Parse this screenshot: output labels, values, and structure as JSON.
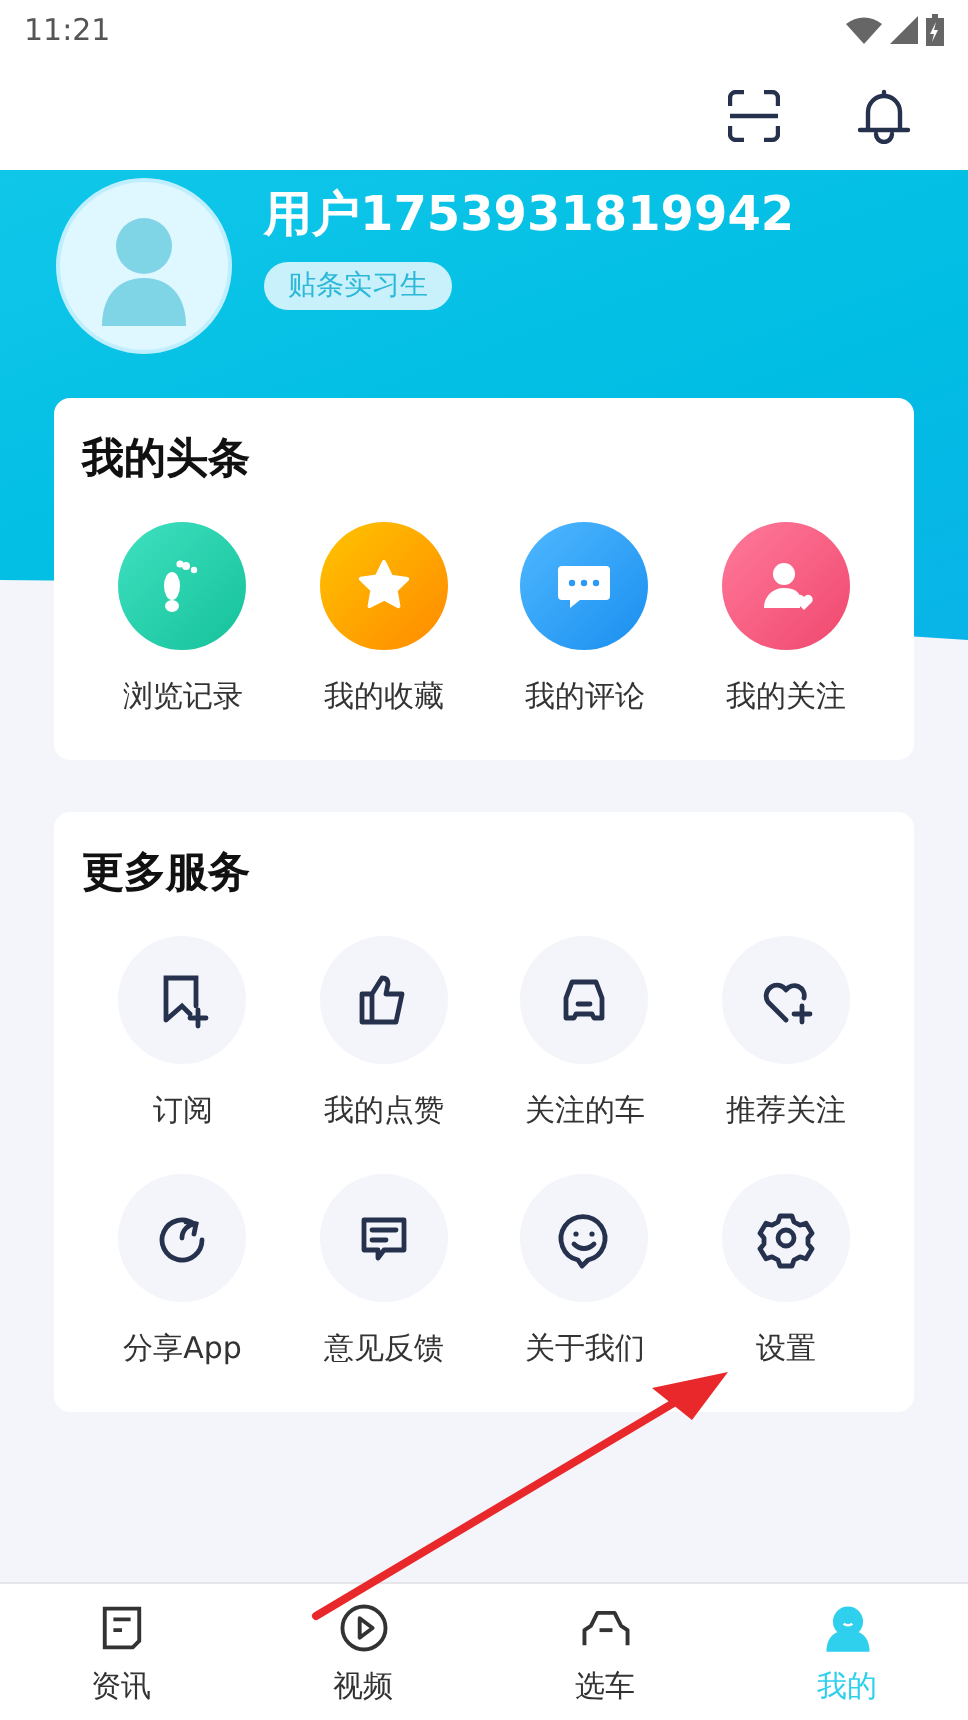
{
  "status_bar": {
    "time": "11:21"
  },
  "profile": {
    "name": "用户1753931819942",
    "badge": "贴条实习生"
  },
  "sections": [
    {
      "title": "我的头条",
      "kind": "colored",
      "items": [
        {
          "label": "浏览记录"
        },
        {
          "label": "我的收藏"
        },
        {
          "label": "我的评论"
        },
        {
          "label": "我的关注"
        }
      ]
    },
    {
      "title": "更多服务",
      "kind": "plain",
      "items": [
        {
          "label": "订阅"
        },
        {
          "label": "我的点赞"
        },
        {
          "label": "关注的车"
        },
        {
          "label": "推荐关注"
        },
        {
          "label": "分享App"
        },
        {
          "label": "意见反馈"
        },
        {
          "label": "关于我们"
        },
        {
          "label": "设置"
        }
      ]
    }
  ],
  "bottom_nav": [
    {
      "label": "资讯",
      "selected": false
    },
    {
      "label": "视频",
      "selected": false
    },
    {
      "label": "选车",
      "selected": false
    },
    {
      "label": "我的",
      "selected": true
    }
  ]
}
